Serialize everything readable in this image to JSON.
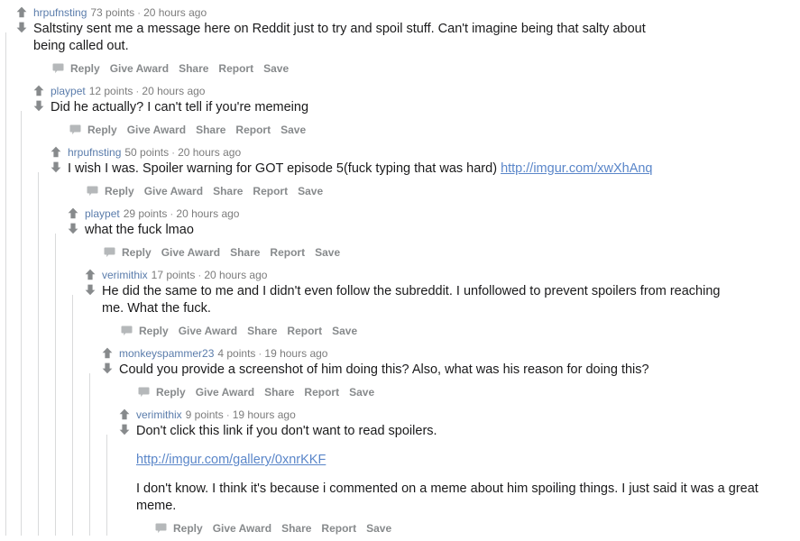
{
  "page": {
    "site": "reddit",
    "view": "comment-thread",
    "background_color": "#ffffff",
    "text_color": "#1a1a1b",
    "username_color": "#5a7cab",
    "link_color": "#5a86c9",
    "meta_color": "#7c7c7c",
    "action_color": "#878a8c",
    "threadline_color": "#d9dadb"
  },
  "labels": {
    "points_suffix": "points",
    "separator": "·",
    "reply": "Reply",
    "give_award": "Give Award",
    "share": "Share",
    "report": "Report",
    "save": "Save",
    "upvote_icon": "upvote-arrow-icon",
    "downvote_icon": "downvote-arrow-icon",
    "comment_bubble_icon": "comment-bubble-icon"
  },
  "comments": [
    {
      "id": "c0",
      "depth": 0,
      "author": "hrpufnsting",
      "points": "73 points",
      "time": "20 hours ago",
      "paragraphs": [
        {
          "text": "Saltstiny sent me a message here on Reddit just to try and spoil stuff. Can't imagine being that salty about being called out."
        }
      ]
    },
    {
      "id": "c1",
      "depth": 1,
      "author": "playpet",
      "points": "12 points",
      "time": "20 hours ago",
      "paragraphs": [
        {
          "text": "Did he actually? I can't tell if you're memeing"
        }
      ]
    },
    {
      "id": "c2",
      "depth": 2,
      "author": "hrpufnsting",
      "points": "50 points",
      "time": "20 hours ago",
      "paragraphs": [
        {
          "text": "I wish I was. Spoiler warning for GOT episode 5(fuck typing that was hard) ",
          "link_text": "http://imgur.com/xwXhAnq"
        }
      ]
    },
    {
      "id": "c3",
      "depth": 3,
      "author": "playpet",
      "points": "29 points",
      "time": "20 hours ago",
      "paragraphs": [
        {
          "text": "what the fuck lmao"
        }
      ]
    },
    {
      "id": "c4",
      "depth": 4,
      "author": "verimithix",
      "points": "17 points",
      "time": "20 hours ago",
      "paragraphs": [
        {
          "text": "He did the same to me and I didn't even follow the subreddit. I unfollowed to prevent spoilers from reaching me. What the fuck."
        }
      ]
    },
    {
      "id": "c5",
      "depth": 5,
      "author": "monkeyspammer23",
      "points": "4 points",
      "time": "19 hours ago",
      "paragraphs": [
        {
          "text": "Could you provide a screenshot of him doing this? Also, what was his reason for doing this?"
        }
      ]
    },
    {
      "id": "c6",
      "depth": 6,
      "author": "verimithix",
      "points": "9 points",
      "time": "19 hours ago",
      "paragraphs": [
        {
          "text": "Don't click this link if you don't want to read spoilers."
        },
        {
          "text": "",
          "link_text": "http://imgur.com/gallery/0xnrKKF"
        },
        {
          "text": "I don't know. I think it's because i commented on a meme about him spoiling things. I just said it was a great meme."
        }
      ]
    }
  ]
}
